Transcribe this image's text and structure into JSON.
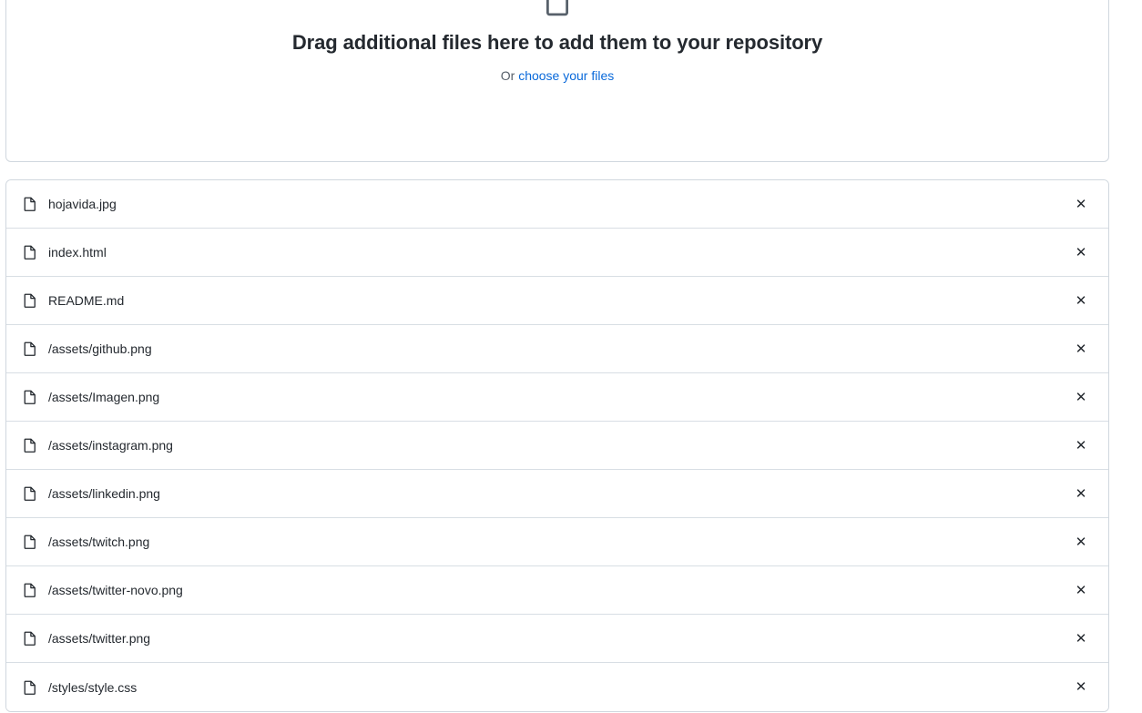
{
  "dropzone": {
    "icon": "upload-file-icon",
    "title": "Drag additional files here to add them to your repository",
    "or_text": "Or ",
    "choose_link": "choose your files"
  },
  "file_list": {
    "remove_label": "✕",
    "file_icon": "file-icon",
    "files": [
      {
        "name": "hojavida.jpg"
      },
      {
        "name": "index.html"
      },
      {
        "name": "README.md"
      },
      {
        "name": "/assets/github.png"
      },
      {
        "name": "/assets/Imagen.png"
      },
      {
        "name": "/assets/instagram.png"
      },
      {
        "name": "/assets/linkedin.png"
      },
      {
        "name": "/assets/twitch.png"
      },
      {
        "name": "/assets/twitter-novo.png"
      },
      {
        "name": "/assets/twitter.png"
      },
      {
        "name": "/styles/style.css"
      }
    ]
  },
  "colors": {
    "border": "#d0d7de",
    "row_divider": "#d8dee4",
    "text": "#24292f",
    "muted": "#57606a",
    "link": "#0969da",
    "background": "#ffffff"
  }
}
